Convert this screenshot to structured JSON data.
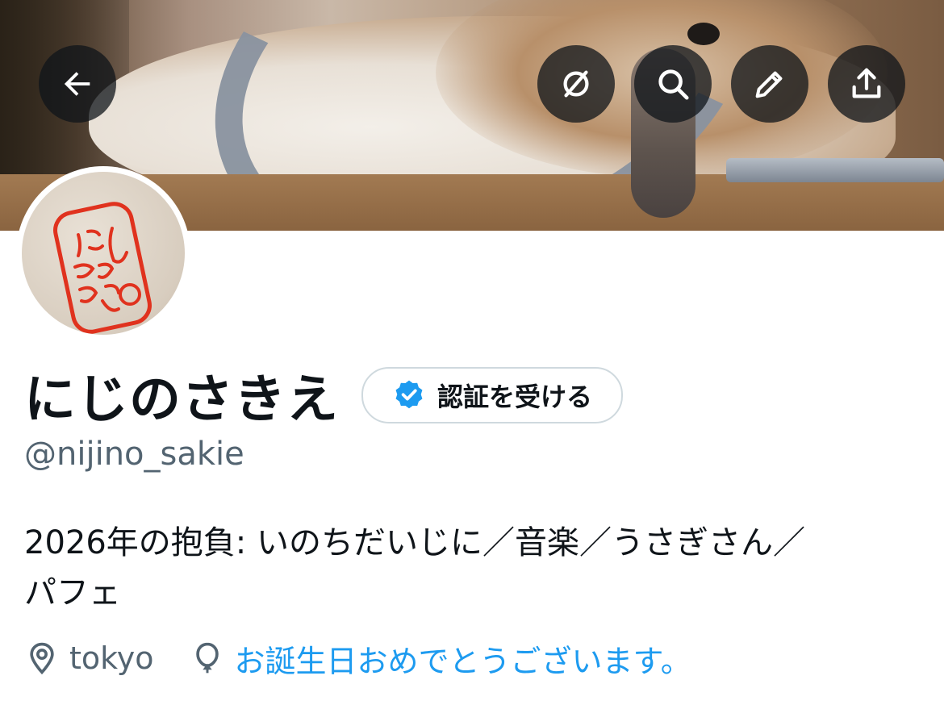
{
  "header": {
    "back_icon": "arrow-left-icon",
    "actions": [
      {
        "name": "mute-icon",
        "label": ""
      },
      {
        "name": "search-icon",
        "label": ""
      },
      {
        "name": "pencil-icon",
        "label": ""
      },
      {
        "name": "share-icon",
        "label": ""
      }
    ]
  },
  "profile": {
    "display_name": "にじのさきえ",
    "verify_label": "認証を受ける",
    "handle": "@nijino_sakie",
    "bio_line1": "2026年の抱負: いのちだいじに／音楽／うさぎさん／",
    "bio_line2": "パフェ",
    "location": "tokyo",
    "birthday": "お誕生日おめでとうございます。",
    "avatar_text": "にじのさきえ"
  },
  "colors": {
    "text": "#0f1419",
    "secondary": "#536471",
    "accent": "#1d9bf0",
    "border": "#cfd9de",
    "stamp_red": "#e0321e"
  }
}
